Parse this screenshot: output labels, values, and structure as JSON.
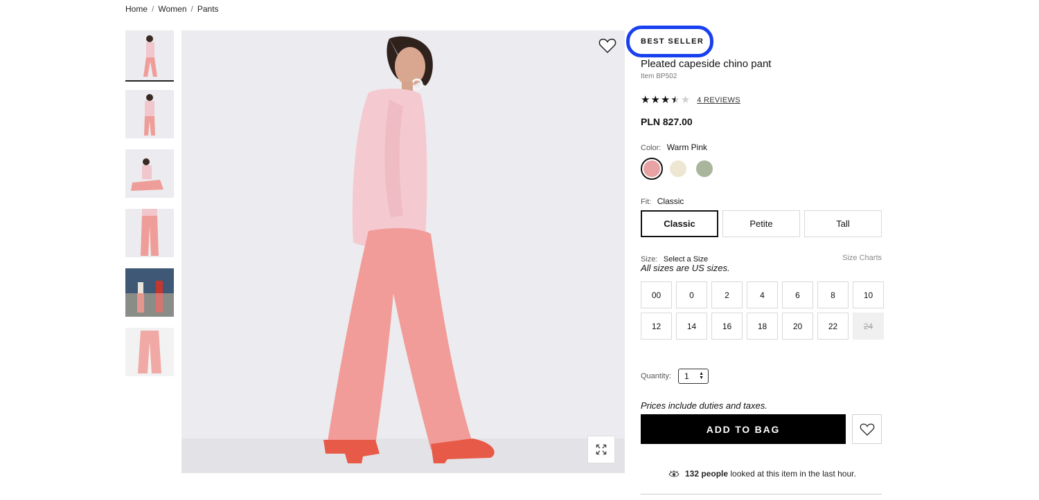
{
  "breadcrumb": [
    "Home",
    "Women",
    "Pants"
  ],
  "breadcrumb_separator": "/",
  "thumbnails": [
    "thumb-pink-outfit-1",
    "thumb-pink-outfit-2",
    "thumb-sitting",
    "thumb-pants-closeup",
    "thumb-beach-group",
    "thumb-pants-flat"
  ],
  "product": {
    "badge": "BEST SELLER",
    "title": "Pleated capeside chino pant",
    "item_number": "Item BP502",
    "rating": 3.5,
    "reviews_label": "4 REVIEWS",
    "price": "PLN 827.00"
  },
  "color": {
    "label": "Color:",
    "value": "Warm Pink",
    "swatches": [
      {
        "name": "Warm Pink",
        "hex": "#e9a2a3",
        "selected": true
      },
      {
        "name": "Natural",
        "hex": "#ece6d2",
        "selected": false
      },
      {
        "name": "Sage",
        "hex": "#a9b69c",
        "selected": false
      }
    ]
  },
  "fit": {
    "label": "Fit:",
    "value": "Classic",
    "options": [
      {
        "label": "Classic",
        "selected": true
      },
      {
        "label": "Petite",
        "selected": false
      },
      {
        "label": "Tall",
        "selected": false
      }
    ]
  },
  "size": {
    "label": "Size:",
    "value": "Select a Size",
    "charts_link": "Size Charts",
    "note": "All sizes are US sizes.",
    "options": [
      {
        "label": "00",
        "available": true
      },
      {
        "label": "0",
        "available": true
      },
      {
        "label": "2",
        "available": true
      },
      {
        "label": "4",
        "available": true
      },
      {
        "label": "6",
        "available": true
      },
      {
        "label": "8",
        "available": true
      },
      {
        "label": "10",
        "available": true
      },
      {
        "label": "12",
        "available": true
      },
      {
        "label": "14",
        "available": true
      },
      {
        "label": "16",
        "available": true
      },
      {
        "label": "18",
        "available": true
      },
      {
        "label": "20",
        "available": true
      },
      {
        "label": "22",
        "available": true
      },
      {
        "label": "24",
        "available": false
      }
    ]
  },
  "quantity": {
    "label": "Quantity:",
    "value": "1"
  },
  "purchase": {
    "prices_note": "Prices include duties and taxes.",
    "add_to_bag": "ADD TO BAG"
  },
  "social_proof": {
    "count": "132 people",
    "text": "looked at this item in the last hour."
  },
  "colors": {
    "accent_ring": "#1840f0",
    "primary_button": "#000000"
  }
}
